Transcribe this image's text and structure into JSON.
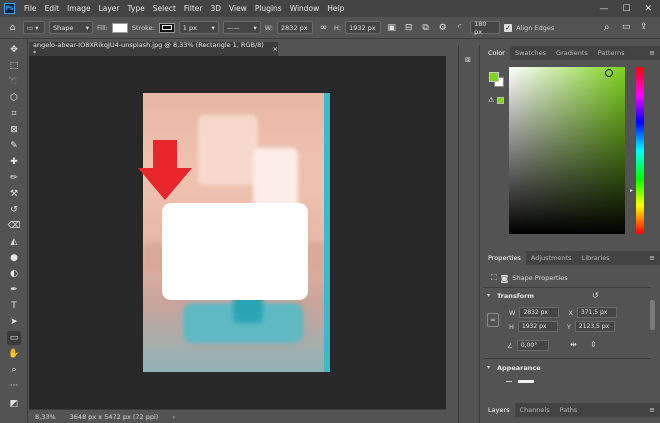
{
  "app": {
    "logo_text": "Ps",
    "menu": [
      "File",
      "Edit",
      "Image",
      "Layer",
      "Type",
      "Select",
      "Filter",
      "3D",
      "View",
      "Plugins",
      "Window",
      "Help"
    ],
    "window_controls": [
      "—",
      "☐",
      "✕"
    ]
  },
  "options_bar": {
    "mode_value": "Shape",
    "fill_label": "Fill:",
    "stroke_label": "Stroke:",
    "stroke_width": "1 px",
    "w_label": "W:",
    "w_value": "2832 px",
    "link_icon": "link-icon",
    "h_label": "H:",
    "h_value": "1932 px",
    "corner_radius": "180 px",
    "align_edges_label": "Align Edges",
    "colors": {
      "fill": "#ffffff",
      "stroke": "#111111"
    }
  },
  "document": {
    "tab_title": "angelo-abear-IO8XRikqJU4-unsplash.jpg @ 8,33% (Rectangle 1, RGB/8) *",
    "tab_close": "×",
    "zoom": "8,33%",
    "dimensions": "3648 px x 5472 px (72 ppi)",
    "status_arrow": "›"
  },
  "color_panel": {
    "tabs": [
      "Color",
      "Swatches",
      "Gradients",
      "Patterns"
    ],
    "active_tab": "Color",
    "foreground": "#7ed321",
    "background": "#ffffff",
    "menu_icon": "≡"
  },
  "properties_panel": {
    "tabs": [
      "Properties",
      "Adjustments",
      "Libraries"
    ],
    "active_tab": "Properties",
    "menu_icon": "≡",
    "header": "Shape Properties",
    "transform_title": "Transform",
    "w_label": "W",
    "w_value": "2832 px",
    "x_label": "X",
    "x_value": "371,5 px",
    "h_label": "H",
    "h_value": "1932 px",
    "y_label": "Y",
    "y_value": "2123,5 px",
    "angle_value": "0,00°",
    "appearance_title": "Appearance"
  },
  "layers_panel": {
    "tabs": [
      "Layers",
      "Channels",
      "Paths"
    ],
    "active_tab": "Layers",
    "menu_icon": "≡"
  },
  "accent_colors": {
    "arrow": "#e8262b",
    "selected_shape": "#ffffff"
  }
}
